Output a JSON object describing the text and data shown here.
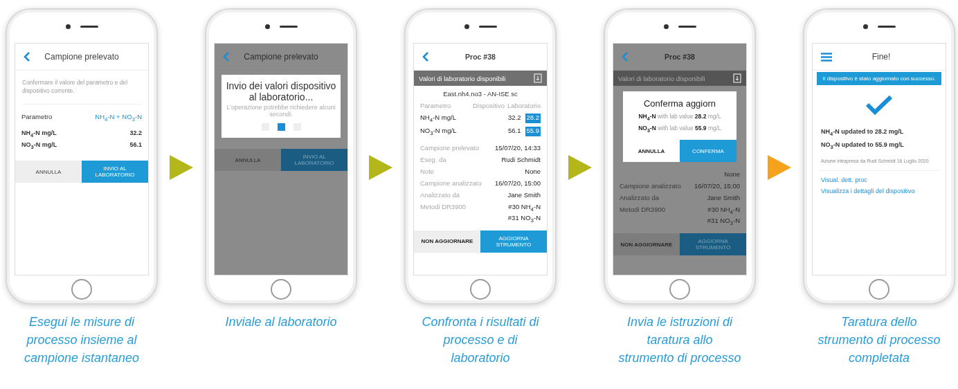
{
  "steps": [
    {
      "caption": "Esegui le misure di processo insieme al campione istantaneo",
      "screen": {
        "kind": "confirm",
        "dimmed": false,
        "header": {
          "title": "Campione prelevato"
        },
        "intro": "Confermare il valore del parametro e del dispositivo corrente.",
        "param_label": "Parametro",
        "param_value": "NH$_{4}$-N + NO$_{3}$-N",
        "readings": [
          {
            "name": "NH$_{4}$-N mg/L",
            "value": "32.2"
          },
          {
            "name": "NO$_{3}$-N mg/L",
            "value": "56.1"
          }
        ],
        "buttons": [
          {
            "label": "ANNULLA",
            "primary": false
          },
          {
            "label": "INVIO AL LABORATORIO",
            "primary": true
          }
        ]
      }
    },
    {
      "caption": "Inviale al laboratorio",
      "screen": {
        "kind": "sending",
        "dimmed": true,
        "header": {
          "title": "Campione prelevato"
        },
        "dialog": {
          "title": "Invio dei valori dispositivo al laboratorio...",
          "note": "L'operazione potrebbe richiedere alcuni secondi.",
          "dots": [
            {
              "selected": false
            },
            {
              "selected": true
            },
            {
              "selected": false
            }
          ]
        },
        "buttons": [
          {
            "label": "ANNULLA",
            "primary": false
          },
          {
            "label": "INVIO AL LABORATORIO",
            "primary": true
          }
        ]
      }
    },
    {
      "caption": "Confronta i risultati di processo e di laboratorio",
      "screen": {
        "kind": "compare",
        "dimmed": false,
        "header": {
          "title": "Proc #38"
        },
        "banner": "Valori di laboratorio disponibili",
        "device": "East.nh4.no3 - AN-ISE sc",
        "columns": [
          "Parametro",
          "Dispositivo",
          "Laboratorio"
        ],
        "readings": [
          {
            "name": "NH$_{4}$-N mg/L",
            "device": "32.2",
            "lab": "28.2"
          },
          {
            "name": "NO$_{3}$-N mg/L",
            "device": "56.1",
            "lab": "55.9"
          }
        ],
        "details": [
          {
            "label": "Campione prelevato",
            "values": [
              "15/07/20, 14:33"
            ]
          },
          {
            "label": "Eseg. da",
            "values": [
              "Rudi Schmidt"
            ]
          },
          {
            "label": "Note",
            "values": [
              "None"
            ]
          },
          {
            "label": "Campione analizzato",
            "values": [
              "16/07/20, 15:00"
            ]
          },
          {
            "label": "Analizzato da",
            "values": [
              "Jane Smith"
            ]
          },
          {
            "label": "Metodi DR3900",
            "values": [
              "#30 NH$_{4}$-N",
              "#31 NO$_{3}$-N"
            ]
          }
        ],
        "buttons": [
          {
            "label": "NON AGGIORNARE",
            "primary": false
          },
          {
            "label": "AGGIORNA STRUMENTO",
            "primary": true
          }
        ]
      }
    },
    {
      "caption": "Invia le istruzioni di taratura allo strumento di processo",
      "screen": {
        "kind": "update_confirm",
        "dimmed": true,
        "header": {
          "title": "Proc #38"
        },
        "banner": "Valori di laboratorio disponibili",
        "dialog": {
          "title": "Conferma aggiorn",
          "lines": [
            "**NH$_{4}$-N** with lab value **28.2** mg/L",
            "**NO$_{3}$-N** with lab value **55.9** mg/L"
          ],
          "buttons": [
            {
              "label": "ANNULLA",
              "primary": false
            },
            {
              "label": "CONFERMA",
              "primary": true
            }
          ]
        },
        "details": [
          {
            "values": [
              "None"
            ]
          },
          {
            "label": "Campione analizzato",
            "values": [
              "16/07/20, 15:00"
            ]
          },
          {
            "label": "Analizzato da",
            "values": [
              "Jane Smith"
            ]
          },
          {
            "label": "Metodi DR3900",
            "values": [
              "#30 NH$_{4}$-N",
              "#31 NO$_{3}$-N"
            ]
          }
        ],
        "buttons": [
          {
            "label": "NON AGGIORNARE",
            "primary": false
          },
          {
            "label": "AGGIORNA STRUMENTO",
            "primary": true
          }
        ]
      }
    },
    {
      "caption": "Taratura dello strumento di processo completata",
      "screen": {
        "kind": "done",
        "dimmed": false,
        "header": {
          "title": "Fine!"
        },
        "banner": "Il dispositivo è stato aggiornato con successo.",
        "results": [
          "NH$_{4}$-N updated to 28.2 mg/L",
          "NO$_{3}$-N updated to 55.9 mg/L"
        ],
        "footnote": "Azione intrapresa da Rudi Schmidt 16 Luglio 2020",
        "links": [
          "Visual. dett. proc",
          "Visualizza i dettagli del dispositivo"
        ]
      }
    }
  ],
  "arrows": [
    {
      "color": "#b3b71a"
    },
    {
      "color": "#b3b71a"
    },
    {
      "color": "#b3b71a"
    },
    {
      "color": "#f6a21d"
    }
  ]
}
